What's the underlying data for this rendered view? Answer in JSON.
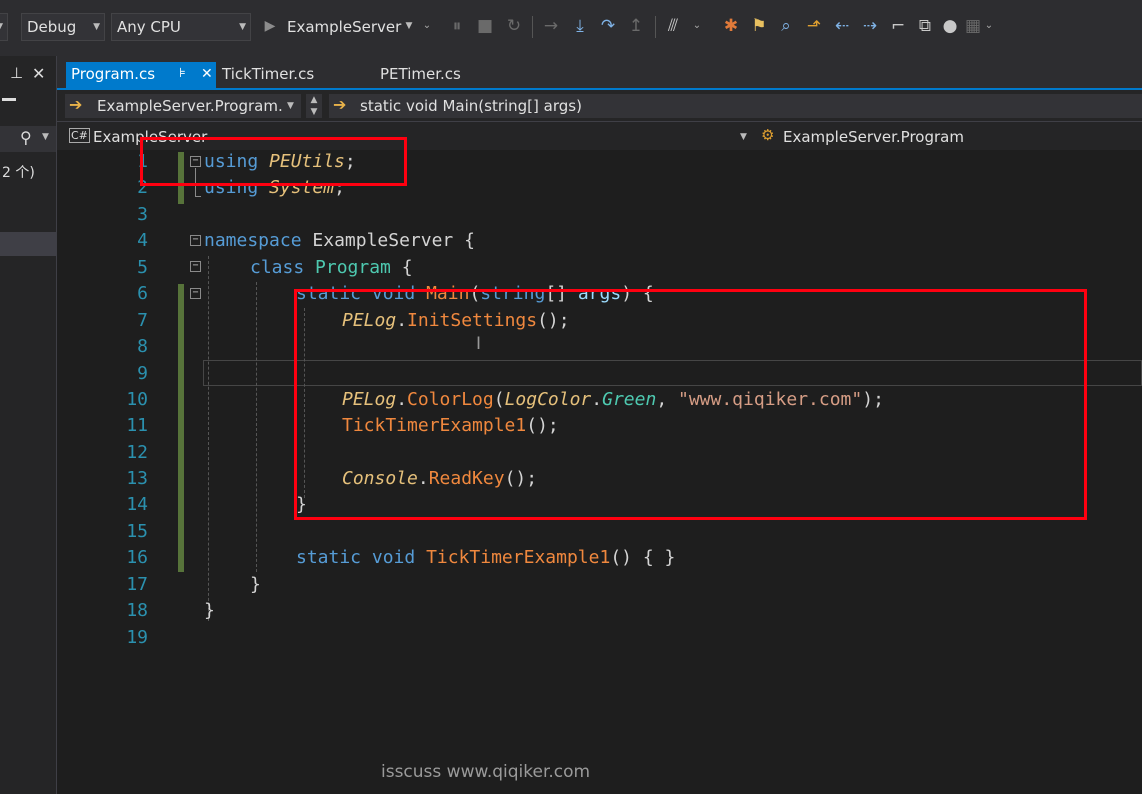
{
  "toolbar": {
    "config": "Debug",
    "platform": "Any CPU",
    "startup_project": "ExampleServer"
  },
  "left_panel": {
    "count_text": "2 个)"
  },
  "tabs": [
    {
      "label": "Program.cs",
      "pin": "⊧",
      "close": "✕"
    },
    {
      "label": "TickTimer.cs"
    },
    {
      "label": "PETimer.cs"
    }
  ],
  "navbar": {
    "type_dropdown": "ExampleServer.Program.",
    "member_dropdown": "static void Main(string[] args)"
  },
  "nav2": {
    "project": "ExampleServer",
    "scope": "ExampleServer.Program"
  },
  "code": {
    "line_numbers": [
      "1",
      "2",
      "3",
      "4",
      "5",
      "6",
      "7",
      "8",
      "9",
      "10",
      "11",
      "12",
      "13",
      "14",
      "15",
      "16",
      "17",
      "18",
      "19"
    ],
    "l1_kw": "using",
    "l1_ns": "PEUtils",
    "l1_semi": ";",
    "l2_kw": "using",
    "l2_ns": "System",
    "l2_semi": ";",
    "l4_kw": "namespace",
    "l4_name": "ExampleServer",
    "l4_brace": " {",
    "l5_kw": "class",
    "l5_name": "Program",
    "l5_brace": " {",
    "l6_static": "static",
    "l6_void": "void",
    "l6_main": "Main",
    "l6_open": "(",
    "l6_string": "string",
    "l6_arr": "[] ",
    "l6_args": "args",
    "l6_close": ") {",
    "l7_cls": "PELog",
    "l7_dot": ".",
    "l7_mth": "InitSettings",
    "l7_end": "();",
    "l10_cls": "PELog",
    "l10_dot": ".",
    "l10_mth": "ColorLog",
    "l10_open": "(",
    "l10_enum": "LogColor",
    "l10_dot2": ".",
    "l10_member": "Green",
    "l10_comma": ", ",
    "l10_str": "\"www.qiqiker.com\"",
    "l10_end": ");",
    "l11_mth": "TickTimerExample1",
    "l11_end": "();",
    "l13_cls": "Console",
    "l13_dot": ".",
    "l13_mth": "ReadKey",
    "l13_end": "();",
    "l14_brace": "}",
    "l16_static": "static",
    "l16_void": "void",
    "l16_mth": "TickTimerExample1",
    "l16_end": "() { }",
    "l17_brace": "}",
    "l18_brace": "}"
  },
  "watermark": "isscuss www.qiqiker.com",
  "colors": {
    "accent": "#007acc",
    "highlight_box": "#ff0010",
    "keyword": "#569cd6",
    "type": "#4ec9b0",
    "method": "#f0883e",
    "string": "#d69d85"
  }
}
